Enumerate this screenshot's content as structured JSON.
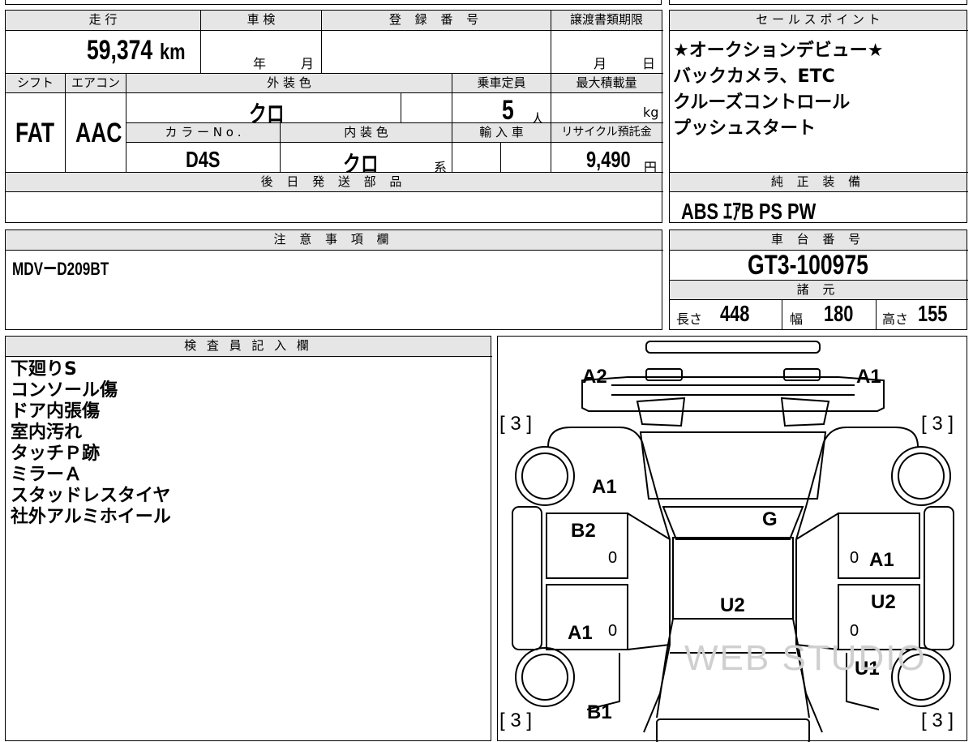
{
  "sheet": {
    "mileage": {
      "label": "走 行",
      "value": "59,374",
      "unit": "km"
    },
    "inspection": {
      "label": "車 検",
      "year_unit": "年",
      "month_unit": "月"
    },
    "registration": {
      "label": "登 録 番 号"
    },
    "transfer_deadline": {
      "label": "譲渡書類期限",
      "month_unit": "月",
      "day_unit": "日"
    },
    "shift": {
      "label": "シフト",
      "value": "FAT"
    },
    "aircon": {
      "label": "エアコン",
      "value": "AAC"
    },
    "exterior_color": {
      "label": "外 装 色",
      "value": "クロ"
    },
    "capacity": {
      "label": "乗車定員",
      "value": "5",
      "unit": "人"
    },
    "max_load": {
      "label": "最大積載量",
      "unit": "kg"
    },
    "color_no": {
      "label": "カ ラ ー N o .",
      "value": "D4S"
    },
    "interior_color": {
      "label": "内 装 色",
      "value": "クロ",
      "suffix": "系"
    },
    "import_car": {
      "label": "輸 入 車"
    },
    "recycle_fee": {
      "label": "リサイクル預託金",
      "value": "9,490",
      "unit": "円"
    },
    "parts_to_ship": {
      "label": "後 日 発 送 部 品"
    },
    "notes": {
      "label": "注 意 事 項 欄",
      "value": "MDVーD209BT"
    },
    "inspector": {
      "label": "検 査 員 記 入 欄",
      "lines": [
        "下廻りS",
        "コンソール傷",
        "ドア内張傷",
        "室内汚れ",
        "タッチＰ跡",
        "ミラーＡ",
        "スタッドレスタイヤ",
        "社外アルミホイール"
      ]
    },
    "sales_points": {
      "label": "セ ー ル ス ポ イ ン ト",
      "lines": [
        "★オークションデビュー★",
        "バックカメラ、ETC",
        "クルーズコントロール",
        "プッシュスタート"
      ]
    },
    "standard_equipment": {
      "label": "純 正 装 備",
      "value": "ABS ｴｱB PS PW"
    },
    "chassis_no": {
      "label": "車 台 番 号",
      "value": "GT3-100975"
    },
    "dimensions": {
      "label": "諸 元",
      "length_label": "長さ",
      "length": "448",
      "width_label": "幅",
      "width": "180",
      "height_label": "高さ",
      "height": "155"
    }
  },
  "diagram": {
    "labels": {
      "front_left": "A2",
      "front_right": "A1",
      "tire_tl": "[ 3 ]",
      "tire_tr": "[ 3 ]",
      "tire_bl": "[ 3 ]",
      "tire_br": "[ 3 ]",
      "fender_left": "A1",
      "windshield": "G",
      "door_fl": "B2",
      "door_fl_zero": "0",
      "door_fr_zero": "0",
      "door_fr": "A1",
      "roof": "U2",
      "door_rr": "U2",
      "door_rr_zero": "0",
      "door_rl": "A1",
      "door_rl_zero": "0",
      "quarter_right": "U1",
      "rear_left": "B1"
    },
    "watermark": "WEB STUDIO"
  }
}
